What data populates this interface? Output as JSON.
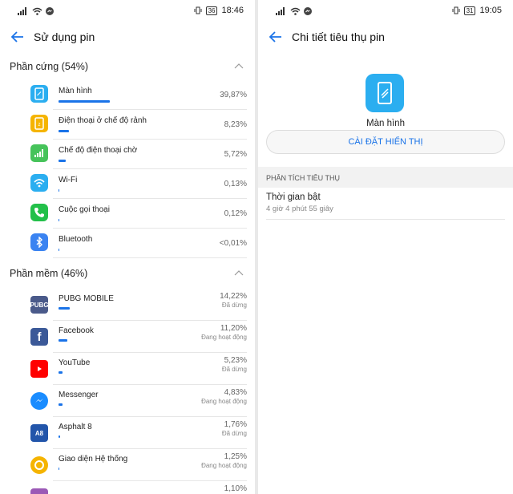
{
  "left": {
    "status": {
      "battery": "36",
      "time": "18:46"
    },
    "title": "Sử dụng pin",
    "hardware": {
      "header": "Phần cứng (54%)",
      "items": [
        {
          "name": "Màn hình",
          "pct": "39,87%",
          "fill": 0.3987,
          "icon": "screen-icon",
          "color": "#2baef0"
        },
        {
          "name": "Điện thoại ở chế độ rảnh",
          "pct": "8,23%",
          "fill": 0.0823,
          "icon": "idle-phone-icon",
          "color": "#f5b400"
        },
        {
          "name": "Chế độ điện thoại chờ",
          "pct": "5,72%",
          "fill": 0.0572,
          "icon": "signal-icon",
          "color": "#46c35a"
        },
        {
          "name": "Wi-Fi",
          "pct": "0,13%",
          "fill": 0.0013,
          "icon": "wifi-icon",
          "color": "#2baef0"
        },
        {
          "name": "Cuộc gọi thoại",
          "pct": "0,12%",
          "fill": 0.0012,
          "icon": "phone-call-icon",
          "color": "#23c04a"
        },
        {
          "name": "Bluetooth",
          "pct": "<0,01%",
          "fill": 0.0001,
          "icon": "bluetooth-icon",
          "color": "#3a83f1"
        }
      ]
    },
    "software": {
      "header": "Phần mềm (46%)",
      "items": [
        {
          "name": "PUBG MOBILE",
          "pct": "14,22%",
          "sub": "Đã dừng",
          "fill": 0.1422,
          "icon": "pubg-app-icon",
          "color": "#4a5a8a"
        },
        {
          "name": "Facebook",
          "pct": "11,20%",
          "sub": "Đang hoạt động",
          "fill": 0.112,
          "icon": "facebook-app-icon",
          "color": "#3b5998"
        },
        {
          "name": "YouTube",
          "pct": "5,23%",
          "sub": "Đã dừng",
          "fill": 0.0523,
          "icon": "youtube-app-icon",
          "color": "#ff0000"
        },
        {
          "name": "Messenger",
          "pct": "4,83%",
          "sub": "Đang hoạt động",
          "fill": 0.0483,
          "icon": "messenger-app-icon",
          "color": "#1a8cff"
        },
        {
          "name": "Asphalt 8",
          "pct": "1,76%",
          "sub": "Đã dừng",
          "fill": 0.0176,
          "icon": "asphalt-app-icon",
          "color": "#2255aa"
        },
        {
          "name": "Giao diện Hệ thống",
          "pct": "1,25%",
          "sub": "Đang hoạt động",
          "fill": 0.0125,
          "icon": "system-ui-app-icon",
          "color": "#f5b400"
        },
        {
          "name": "",
          "pct": "1,10%",
          "sub": "",
          "fill": 0.011,
          "icon": "partial-app-icon",
          "color": "#9b59b6"
        }
      ]
    }
  },
  "right": {
    "status": {
      "battery": "31",
      "time": "19:05"
    },
    "title": "Chi tiết tiêu thụ pin",
    "item_name": "Màn hình",
    "settings_button": "CÀI ĐẶT HIỂN THỊ",
    "section": "PHÂN TÍCH TIÊU THỤ",
    "detail_label": "Thời gian bật",
    "detail_value": "4 giờ 4 phút 55 giây"
  }
}
